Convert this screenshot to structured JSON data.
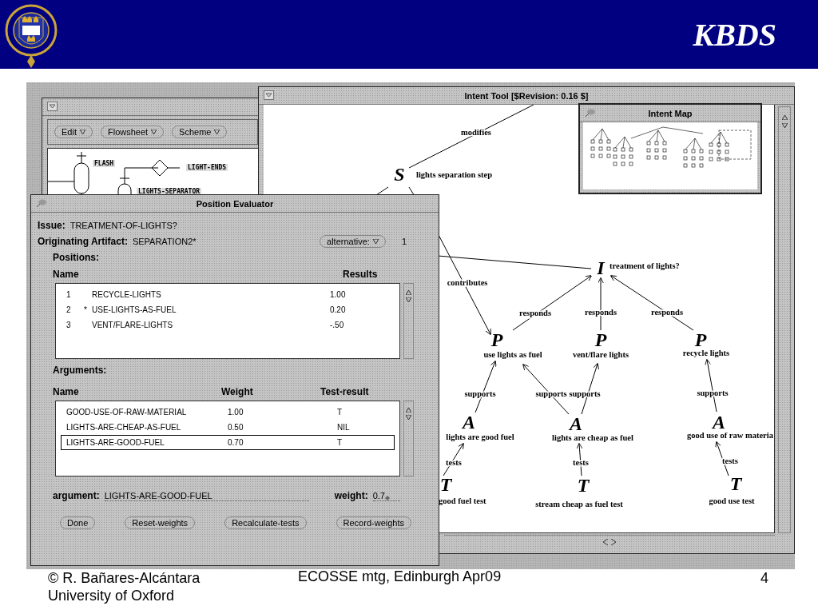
{
  "slide": {
    "title": "KBDS",
    "footer": {
      "author": "© R. Bañares-Alcántara",
      "institution": "University of Oxford",
      "event": "ECOSSE mtg, Edinburgh Apr09",
      "page": "4"
    }
  },
  "flowsheet_window": {
    "menus": [
      "Edit",
      "Flowsheet",
      "Scheme"
    ],
    "units": [
      "FLASH",
      "LIGHT-ENDS",
      "LIGHTS-SEPARATOR"
    ]
  },
  "intent_tool": {
    "title": "Intent Tool [$Revision: 0.16 $]",
    "map_title": "Intent Map",
    "nodes": [
      {
        "letter": "S",
        "label": "lights separation step"
      },
      {
        "letter": "I",
        "label": "treatment of lights?"
      },
      {
        "letter": "P",
        "label": "use lights as fuel"
      },
      {
        "letter": "P",
        "label": "vent/flare lights"
      },
      {
        "letter": "P",
        "label": "recycle lights"
      },
      {
        "letter": "A",
        "label": "lights are good fuel"
      },
      {
        "letter": "A",
        "label": "lights are cheap as fuel"
      },
      {
        "letter": "A",
        "label": "good use of raw materia"
      },
      {
        "letter": "T",
        "label": "good fuel test"
      },
      {
        "letter": "T",
        "label": "stream cheap as fuel test"
      },
      {
        "letter": "T",
        "label": "good use test"
      }
    ],
    "edges": [
      {
        "kind": "line",
        "label": "modifies"
      },
      {
        "kind": "arrow",
        "label": "contributes"
      },
      {
        "kind": "arrow",
        "label": "responds"
      },
      {
        "kind": "arrow",
        "label": "responds"
      },
      {
        "kind": "arrow",
        "label": "responds"
      },
      {
        "kind": "arrow",
        "label": "supports"
      },
      {
        "kind": "arrow",
        "label": "supports"
      },
      {
        "kind": "arrow",
        "label": "supports"
      },
      {
        "kind": "arrow",
        "label": "supports"
      },
      {
        "kind": "arrow",
        "label": "tests"
      },
      {
        "kind": "arrow",
        "label": "tests"
      },
      {
        "kind": "arrow",
        "label": "tests"
      }
    ]
  },
  "position_evaluator": {
    "title": "Position Evaluator",
    "issue_label": "Issue:",
    "issue": "TREATMENT-OF-LIGHTS?",
    "artifact_label": "Originating Artifact:",
    "artifact": "SEPARATION2*",
    "alternative_menu": "alternative:",
    "alternative_value": "1",
    "positions_heading": "Positions:",
    "positions_columns": [
      "Name",
      "Results"
    ],
    "positions": [
      {
        "number": "1",
        "name": "RECYCLE-LIGHTS",
        "result": "1.00"
      },
      {
        "number": "2",
        "mark": "*",
        "name": "USE-LIGHTS-AS-FUEL",
        "result": "0.20"
      },
      {
        "number": "3",
        "name": "VENT/FLARE-LIGHTS",
        "result": "-.50"
      }
    ],
    "arguments_heading": "Arguments:",
    "arguments_columns": [
      "Name",
      "Weight",
      "Test-result"
    ],
    "arguments": [
      {
        "name": "GOOD-USE-OF-RAW-MATERIAL",
        "weight": "1.00",
        "test_result": "T",
        "selected": false
      },
      {
        "name": "LIGHTS-ARE-CHEAP-AS-FUEL",
        "weight": "0.50",
        "test_result": "NIL",
        "selected": false
      },
      {
        "name": "LIGHTS-ARE-GOOD-FUEL",
        "weight": "0.70",
        "test_result": "T",
        "selected": true
      }
    ],
    "argument_field": {
      "label": "argument:",
      "value": "LIGHTS-ARE-GOOD-FUEL"
    },
    "weight_field": {
      "label": "weight:",
      "value": "0.7"
    },
    "buttons": [
      "Done",
      "Reset-weights",
      "Recalculate-tests",
      "Record-weights"
    ]
  }
}
